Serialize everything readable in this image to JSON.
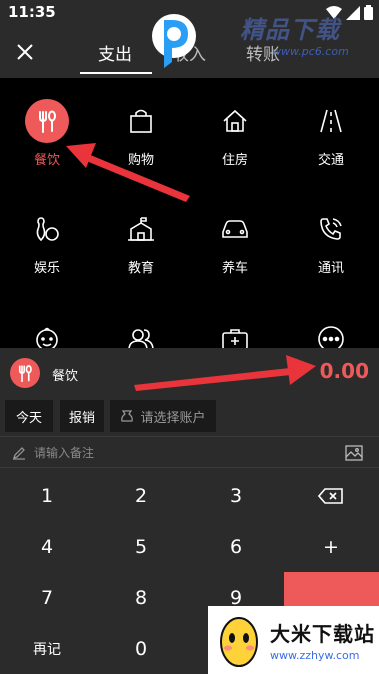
{
  "status_bar": {
    "time": "11:35"
  },
  "header": {
    "tabs": [
      {
        "label": "支出"
      },
      {
        "label": "收入"
      },
      {
        "label": "转账"
      }
    ]
  },
  "watermark_top": {
    "text": "精品下载",
    "url": "www.pc6.com"
  },
  "categories": [
    {
      "label": "餐饮",
      "icon": "fork-spoon-icon",
      "active": true
    },
    {
      "label": "购物",
      "icon": "shopping-bag-icon"
    },
    {
      "label": "住房",
      "icon": "house-icon"
    },
    {
      "label": "交通",
      "icon": "road-icon"
    },
    {
      "label": "娱乐",
      "icon": "bowling-icon"
    },
    {
      "label": "教育",
      "icon": "school-icon"
    },
    {
      "label": "养车",
      "icon": "car-icon"
    },
    {
      "label": "通讯",
      "icon": "phone-icon"
    },
    {
      "label": "",
      "icon": "baby-icon"
    },
    {
      "label": "",
      "icon": "people-icon"
    },
    {
      "label": "",
      "icon": "medical-kit-icon"
    },
    {
      "label": "",
      "icon": "more-icon"
    }
  ],
  "summary": {
    "category": "餐饮",
    "amount": "0.00"
  },
  "options": {
    "today": "今天",
    "reimburse": "报销",
    "account_placeholder": "请选择账户"
  },
  "remark": {
    "placeholder": "请输入备注"
  },
  "keypad": {
    "keys": [
      "1",
      "2",
      "3",
      "",
      "4",
      "5",
      "6",
      "+",
      "7",
      "8",
      "9",
      "",
      "再记",
      "0",
      "",
      ""
    ]
  },
  "watermark_bottom": {
    "title": "大米下载站",
    "url": "www.zzhyw.com"
  },
  "colors": {
    "accent": "#ee5a5a",
    "panel": "#2b2b2b",
    "background": "#000000"
  }
}
